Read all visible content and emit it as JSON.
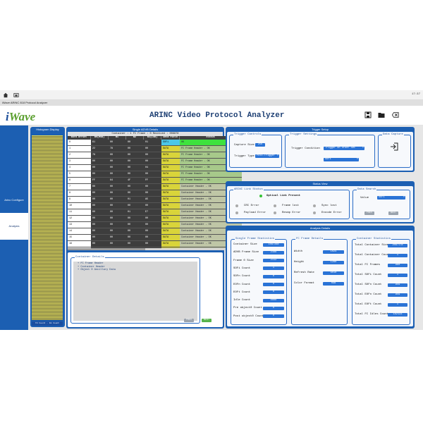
{
  "topbar": {
    "clock": "17:37"
  },
  "window": {
    "title": "iWave ARINC 818 Protocol Analyzer"
  },
  "header": {
    "logo": "iWave",
    "app_title": "ARINC Video Protocol Analyzer"
  },
  "sidebar": {
    "items": [
      {
        "label": "Arinc Configure"
      },
      {
        "label": "Analysis"
      }
    ]
  },
  "histogram": {
    "title": "Histogram Display",
    "footer": "Y2 Count · 18 Count"
  },
  "adwb": {
    "title": "Single ADVB Details",
    "subtitle": "Container : 1   FC Frame : 0   Received : 008878",
    "columns": [
      "Word Offset",
      "B0(MSB)",
      "B1",
      "B2",
      "B3(LSB)",
      "Data Field",
      "Status"
    ],
    "rows": [
      [
        "0",
        "61",
        "00",
        "00",
        "01",
        "SOFi",
        "OK"
      ],
      [
        "1",
        "22",
        "78",
        "00",
        "00",
        "DATA",
        "FC Frame Header - OK"
      ],
      [
        "2",
        "78",
        "00",
        "00",
        "00",
        "DATA",
        "FC Frame Header - OK"
      ],
      [
        "3",
        "00",
        "00",
        "00",
        "00",
        "DATA",
        "FC Frame Header - OK"
      ],
      [
        "4",
        "00",
        "00",
        "00",
        "04",
        "DATA",
        "FC Frame Header - OK"
      ],
      [
        "5",
        "00",
        "00",
        "00",
        "00",
        "DATA",
        "FC Frame Header - OK"
      ],
      [
        "6",
        "FF",
        "64",
        "4F",
        "FF",
        "DATA",
        "FC Frame Header - OK"
      ],
      [
        "7",
        "00",
        "00",
        "00",
        "00",
        "DATA",
        "Container Header - OK"
      ],
      [
        "8",
        "00",
        "00",
        "00",
        "00",
        "DATA",
        "Container Header - OK"
      ],
      [
        "9",
        "00",
        "00",
        "01",
        "A5",
        "DATA",
        "Container Header - OK"
      ],
      [
        "10",
        "00",
        "00",
        "00",
        "00",
        "DATA",
        "Container Header - OK"
      ],
      [
        "11",
        "00",
        "00",
        "01",
        "E7",
        "DATA",
        "Container Header - OK"
      ],
      [
        "12",
        "00",
        "00",
        "00",
        "00",
        "DATA",
        "Container Header - OK"
      ],
      [
        "13",
        "00",
        "00",
        "00",
        "00",
        "DATA",
        "Container Header - OK"
      ],
      [
        "14",
        "00",
        "00",
        "00",
        "00",
        "DATA",
        "Container Header - OK"
      ],
      [
        "15",
        "00",
        "00",
        "00",
        "00",
        "DATA",
        "Container Header - OK"
      ],
      [
        "16",
        "00",
        "00",
        "00",
        "00",
        "DATA",
        "Container Header - OK"
      ],
      [
        "17",
        "00",
        "00",
        "00",
        "00",
        "DATA",
        "Container Header - OK"
      ]
    ]
  },
  "container_details": {
    "title": "Container Details",
    "items": [
      "FC Frame Header",
      "Container Header",
      "Object 0 Ancillary Data"
    ],
    "btn_prev": "PREV",
    "btn_next": "NEXT"
  },
  "trigger_setup": {
    "title": "Trigger Setup",
    "trigger_controls": {
      "title": "Trigger Controls",
      "capture_size_label": "Capture Size",
      "capture_size_value": "256",
      "trigger_type_label": "Trigger Type",
      "trigger_type_value": "Post-Trigger"
    },
    "trigger_settings": {
      "title": "Trigger Settings",
      "condition_label": "Trigger Condition",
      "condition_value": "Trigger on Order Set",
      "sub_value": "SOFi"
    },
    "data_capture": {
      "title": "Data Capture"
    }
  },
  "status_view": {
    "title": "Status View",
    "link_status": {
      "title": "ARINC Link Status",
      "optical": "Optical Link Present",
      "items": [
        "CRC Error",
        "Frame lost",
        "Sync lost",
        "Payload Error",
        "Resmp Error",
        "Encode Error"
      ]
    },
    "data_search": {
      "title": "Data Search",
      "value_label": "Value",
      "value": "SOFi",
      "prev": "PREV",
      "next": "NEXT"
    }
  },
  "analysis": {
    "title": "Analysis Details",
    "single_frame": {
      "title": "Single Frame Statistics",
      "rows": [
        {
          "label": "Container Size",
          "value": "1087288"
        },
        {
          "label": "ADVB Frame Size",
          "value": "2168"
        },
        {
          "label": "Frame 0 Size",
          "value": "2112"
        },
        {
          "label": "SOFi Count",
          "value": "1"
        },
        {
          "label": "SOFn Count",
          "value": "0"
        },
        {
          "label": "EOFn Count",
          "value": "0"
        },
        {
          "label": "EOFt Count",
          "value": "0"
        },
        {
          "label": "Idle Count",
          "value": "0000"
        },
        {
          "label": "Pre object0 Count",
          "value": "0"
        },
        {
          "label": "Post object0 Count",
          "value": "0"
        }
      ]
    },
    "fc_frame": {
      "title": "FC Frame Details",
      "rows": [
        {
          "label": "Width",
          "value": "1024"
        },
        {
          "label": "Height",
          "value": "1280"
        },
        {
          "label": "Refresh Rate",
          "value": "6010"
        },
        {
          "label": "Color Format",
          "value": "RGB"
        }
      ]
    },
    "container_stats": {
      "title": "Container Statistics",
      "rows": [
        {
          "label": "Total Container Size",
          "value": "2087178"
        },
        {
          "label": "Total Container Count",
          "value": "1"
        },
        {
          "label": "Total FC Frames",
          "value": "960"
        },
        {
          "label": "Total SOFi Count",
          "value": "1"
        },
        {
          "label": "Total SOFn Count",
          "value": "959"
        },
        {
          "label": "Total EOFn Count",
          "value": "959"
        },
        {
          "label": "Total EOFt Count",
          "value": "1"
        },
        {
          "label": "Total FC Idles Count",
          "value": "182123"
        }
      ]
    }
  }
}
